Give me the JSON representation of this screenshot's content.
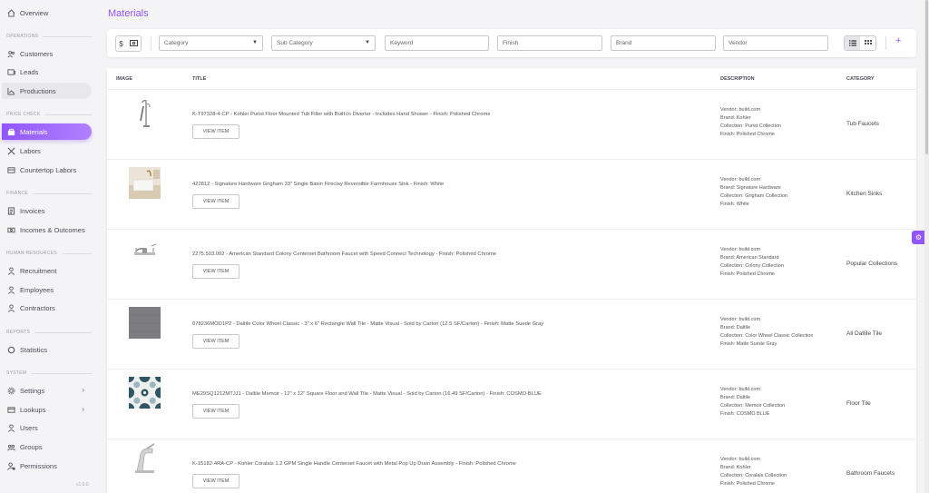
{
  "sidebar": {
    "overview": "Overview",
    "sections": {
      "operations": "OPERATIONS",
      "price_check": "PRICE CHECK",
      "finance": "FINANCE",
      "human_resources": "HUMAN RESOURCES",
      "reports": "REPORTS",
      "system": "SYSTEM"
    },
    "items": {
      "customers": "Customers",
      "leads": "Leads",
      "productions": "Productions",
      "materials": "Materials",
      "labors": "Labors",
      "countertop_labors": "Countertop Labors",
      "invoices": "Invoices",
      "incomes_outcomes": "Incomes & Outcomes",
      "recruitment": "Recruitment",
      "employees": "Employees",
      "contractors": "Contractors",
      "statistics": "Statistics",
      "settings": "Settings",
      "lookups": "Lookups",
      "users": "Users",
      "groups": "Groups",
      "permissions": "Permissions"
    },
    "version": "v1.0.0"
  },
  "page": {
    "title": "Materials"
  },
  "filters": {
    "category": "Category",
    "sub_category": "Sub Category",
    "keyword": "Keyword",
    "finish": "Finish",
    "brand": "Brand",
    "vendor": "Vendor",
    "currency_symbol": "$"
  },
  "table": {
    "headers": {
      "image": "IMAGE",
      "title": "TITLE",
      "description": "DESCRIPTION",
      "category": "CATEGORY"
    },
    "view_label": "VIEW ITEM",
    "rows": [
      {
        "title": "K-T97328-4-CP - Kohler Purist Floor Mounted Tub Filler with Built-In Diverter - Includes Hand Shower - Finish: Polished Chrome",
        "desc": [
          "Vendor: build.com",
          "Brand: Kohler",
          "Collection: Purist Collection",
          "Finish: Polished Chrome"
        ],
        "category": "Tub Faucets"
      },
      {
        "title": "422812 - Signature Hardware Grigham 33\" Single Basin Fireclay Reversible Farmhouse Sink - Finish: White",
        "desc": [
          "Vendor: build.com",
          "Brand: Signature Hardware",
          "Collection: Grigham Collection",
          "Finish: White"
        ],
        "category": "Kitchen Sinks"
      },
      {
        "title": "2275.503.002 - American Standard Colony Centerset Bathroom Faucet with Speed Connect Technology - Finish: Polished Chrome",
        "desc": [
          "Vendor: build.com",
          "Brand: American Standard",
          "Collection: Colony Collection",
          "Finish: Polished Chrome"
        ],
        "category": "Popular Collections"
      },
      {
        "title": "078236MOD1P2 - Daltile Color Wheel Classic - 3\" x 6\" Rectangle Wall Tile - Matte Visual - Sold by Carton (12.5 SF/Carton) - Finish: Matte Suede Gray",
        "desc": [
          "Vendor: build.com",
          "Brand: Daltile",
          "Collection: Color Wheel Classic Collection",
          "Finish: Matte Suede Gray"
        ],
        "category": "All Daltile Tile"
      },
      {
        "title": "ME29SQ1212MTJJ1 - Daltile Memoir - 12\" x 12\" Square Floor and Wall Tile - Matte Visual - Sold by Carton (16.49 SF/Carton) - Finish: COSMO BLUE",
        "desc": [
          "Vendor: build.com",
          "Brand: Daltile",
          "Collection: Memoir Collection",
          "Finish: COSMO BLUE"
        ],
        "category": "Floor Tile"
      },
      {
        "title": "K-15182-4RA-CP - Kohler Coralais 1.2 GPM Single Handle Centerset Faucet with Metal Pop Up Drain Assembly - Finish: Polished Chrome",
        "desc": [
          "Vendor: build.com",
          "Brand: Kohler",
          "Collection: Coralais Collection",
          "Finish: Polished Chrome"
        ],
        "category": "Bathroom Faucets"
      }
    ]
  }
}
